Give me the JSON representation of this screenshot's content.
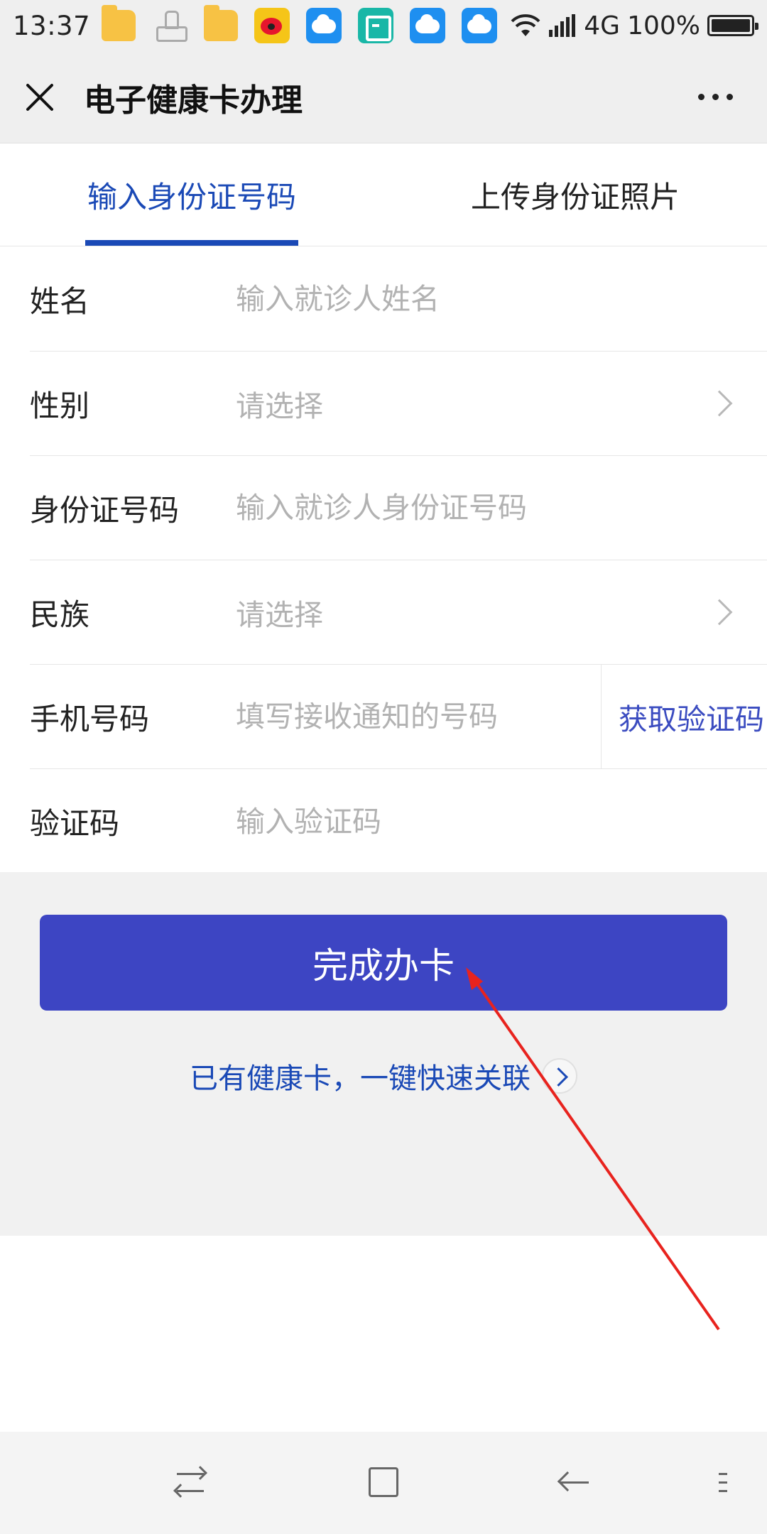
{
  "status_bar": {
    "time": "13:37",
    "network": "4G",
    "battery": "100%",
    "notification_icons": [
      "folder-icon",
      "stamp-icon",
      "folder-icon",
      "weibo-icon",
      "weather-icon",
      "scan-icon",
      "weather-icon",
      "weather-icon"
    ]
  },
  "header": {
    "title": "电子健康卡办理"
  },
  "tabs": [
    {
      "label": "输入身份证号码",
      "active": true
    },
    {
      "label": "上传身份证照片",
      "active": false
    }
  ],
  "form": {
    "name": {
      "label": "姓名",
      "placeholder": "输入就诊人姓名"
    },
    "gender": {
      "label": "性别",
      "placeholder": "请选择"
    },
    "id_number": {
      "label": "身份证号码",
      "placeholder": "输入就诊人身份证号码"
    },
    "ethnicity": {
      "label": "民族",
      "placeholder": "请选择"
    },
    "phone": {
      "label": "手机号码",
      "placeholder": "填写接收通知的号码",
      "sms_button": "获取验证码"
    },
    "code": {
      "label": "验证码",
      "placeholder": "输入验证码"
    }
  },
  "actions": {
    "submit_label": "完成办卡",
    "link_existing": "已有健康卡，一键快速关联"
  },
  "colors": {
    "accent": "#1a49b6",
    "button": "#3d45c3",
    "annotation": "#e8231e"
  }
}
